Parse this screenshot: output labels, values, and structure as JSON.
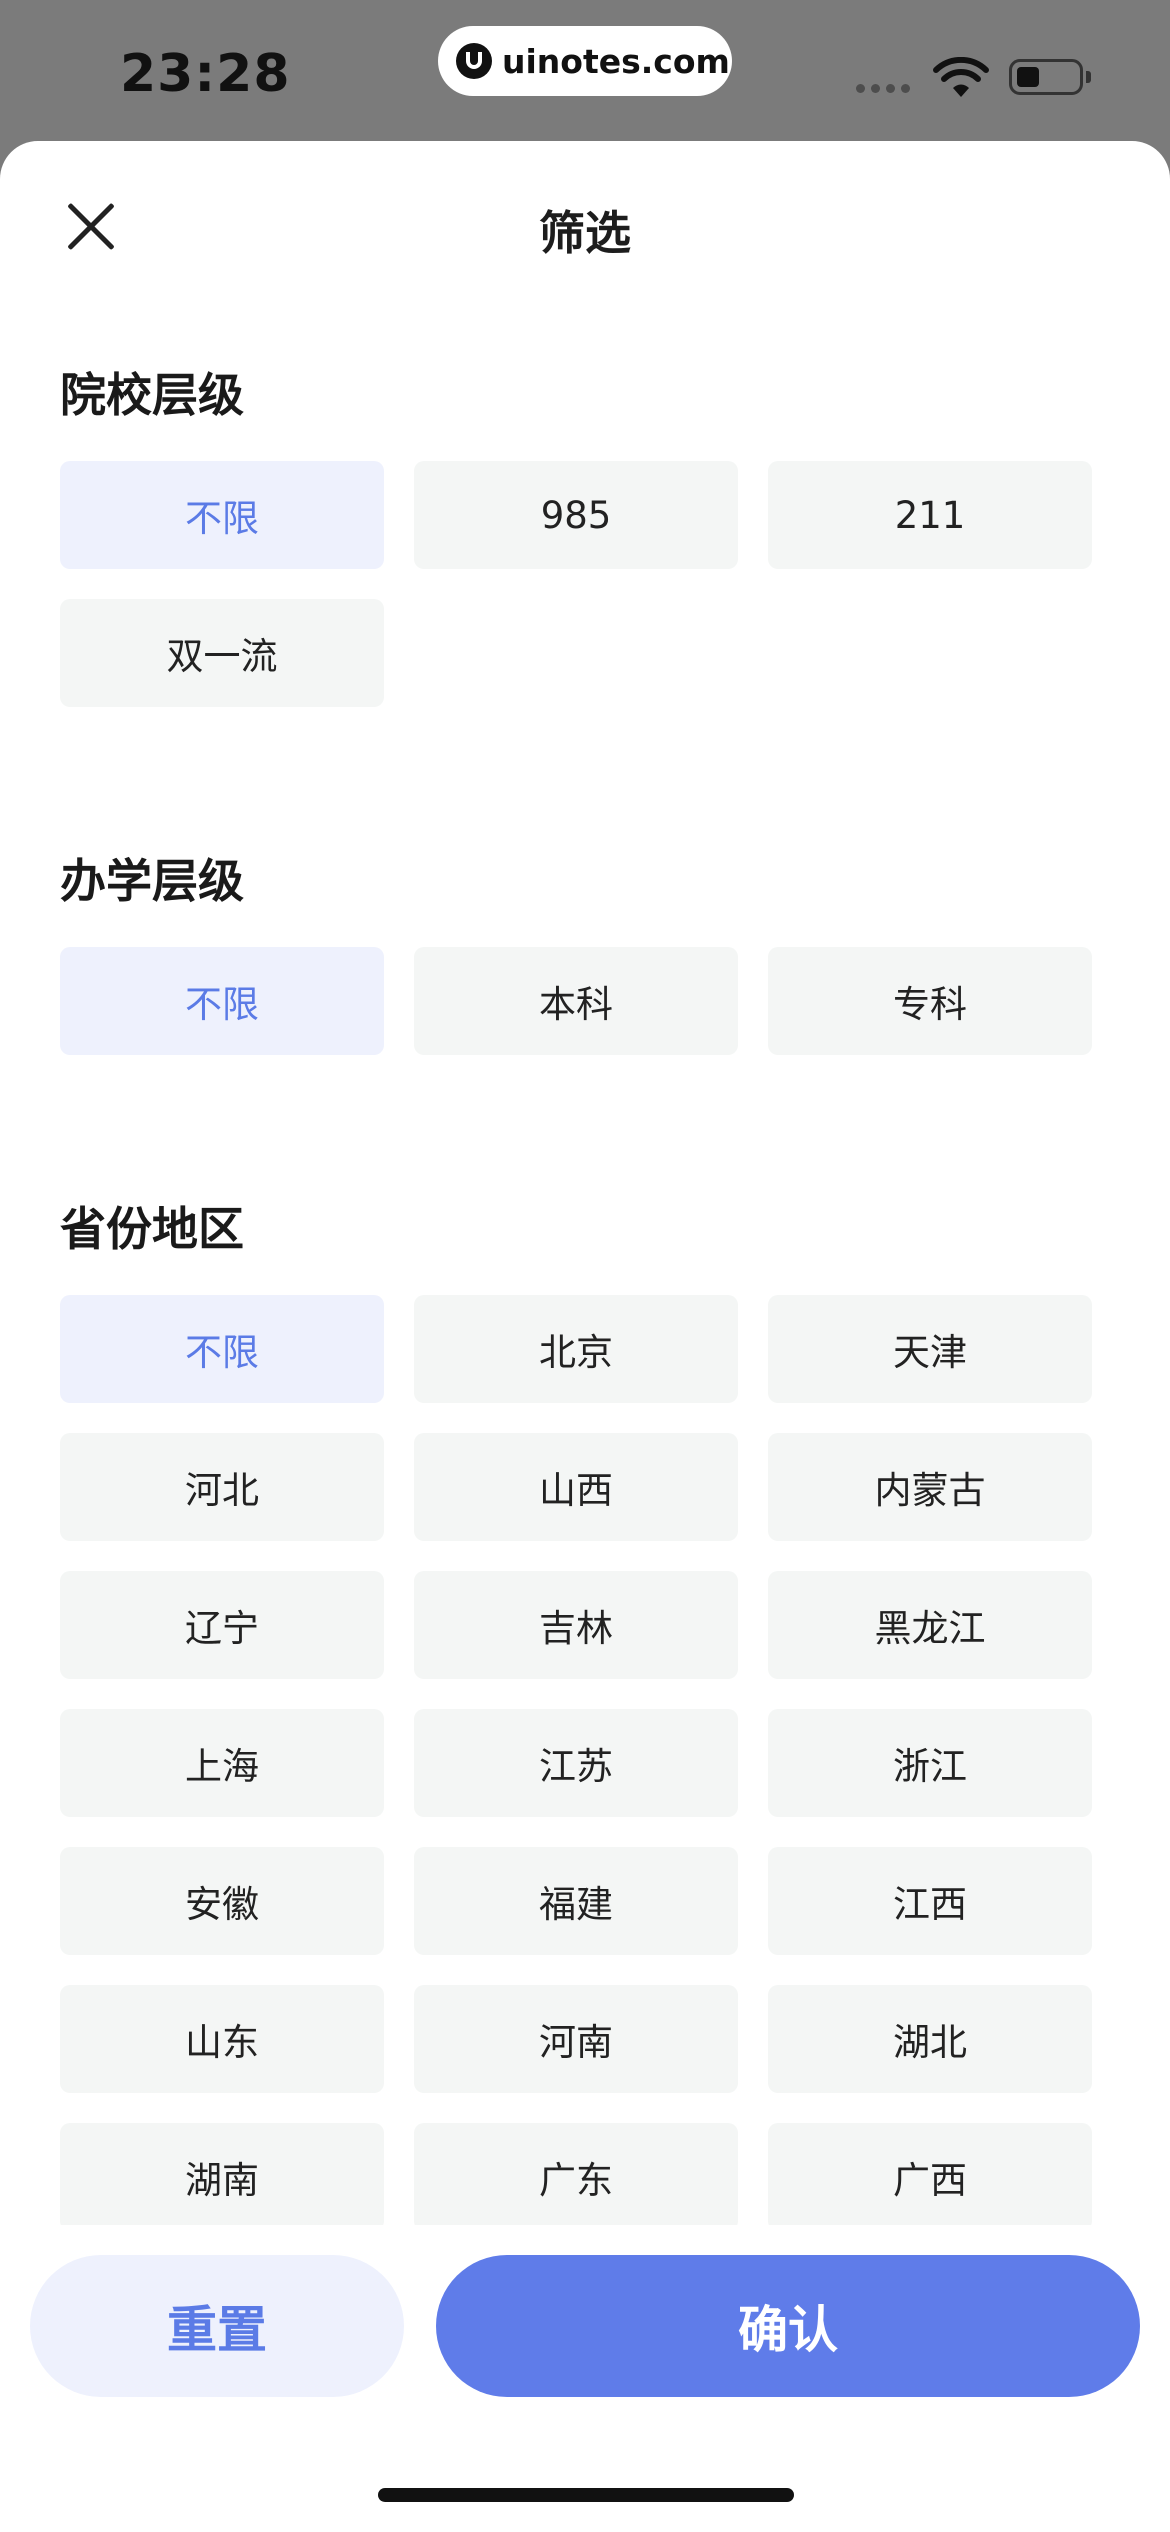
{
  "status_bar": {
    "time": "23:28",
    "url": "uinotes.com",
    "logo_icon": "uinotes-logo-icon",
    "wifi_icon": "wifi-icon",
    "battery_icon": "battery-icon"
  },
  "header": {
    "title": "筛选",
    "close_icon": "close-icon"
  },
  "sections": [
    {
      "title": "院校层级",
      "options": [
        {
          "label": "不限",
          "selected": true
        },
        {
          "label": "985",
          "selected": false
        },
        {
          "label": "211",
          "selected": false
        },
        {
          "label": "双一流",
          "selected": false
        }
      ]
    },
    {
      "title": "办学层级",
      "options": [
        {
          "label": "不限",
          "selected": true
        },
        {
          "label": "本科",
          "selected": false
        },
        {
          "label": "专科",
          "selected": false
        }
      ]
    },
    {
      "title": "省份地区",
      "options": [
        {
          "label": "不限",
          "selected": true
        },
        {
          "label": "北京",
          "selected": false
        },
        {
          "label": "天津",
          "selected": false
        },
        {
          "label": "河北",
          "selected": false
        },
        {
          "label": "山西",
          "selected": false
        },
        {
          "label": "内蒙古",
          "selected": false
        },
        {
          "label": "辽宁",
          "selected": false
        },
        {
          "label": "吉林",
          "selected": false
        },
        {
          "label": "黑龙江",
          "selected": false
        },
        {
          "label": "上海",
          "selected": false
        },
        {
          "label": "江苏",
          "selected": false
        },
        {
          "label": "浙江",
          "selected": false
        },
        {
          "label": "安徽",
          "selected": false
        },
        {
          "label": "福建",
          "selected": false
        },
        {
          "label": "江西",
          "selected": false
        },
        {
          "label": "山东",
          "selected": false
        },
        {
          "label": "河南",
          "selected": false
        },
        {
          "label": "湖北",
          "selected": false
        },
        {
          "label": "湖南",
          "selected": false
        },
        {
          "label": "广东",
          "selected": false
        },
        {
          "label": "广西",
          "selected": false
        }
      ]
    }
  ],
  "footer": {
    "reset_label": "重置",
    "confirm_label": "确认"
  },
  "colors": {
    "accent": "#5f7ce9",
    "selected_text": "#5b7be6",
    "selected_bg": "#eef1fd",
    "option_bg": "#f4f6f5"
  }
}
